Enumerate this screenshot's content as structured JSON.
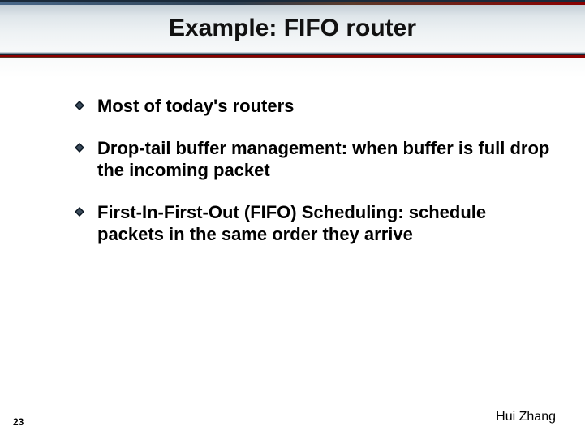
{
  "title": "Example: FIFO router",
  "bullets": [
    {
      "text": "Most of today's routers"
    },
    {
      "text": "Drop-tail buffer management: when buffer is full drop the incoming packet"
    },
    {
      "text": "First-In-First-Out (FIFO) Scheduling: schedule packets in the same order they arrive"
    }
  ],
  "page_number": "23",
  "author": "Hui Zhang"
}
